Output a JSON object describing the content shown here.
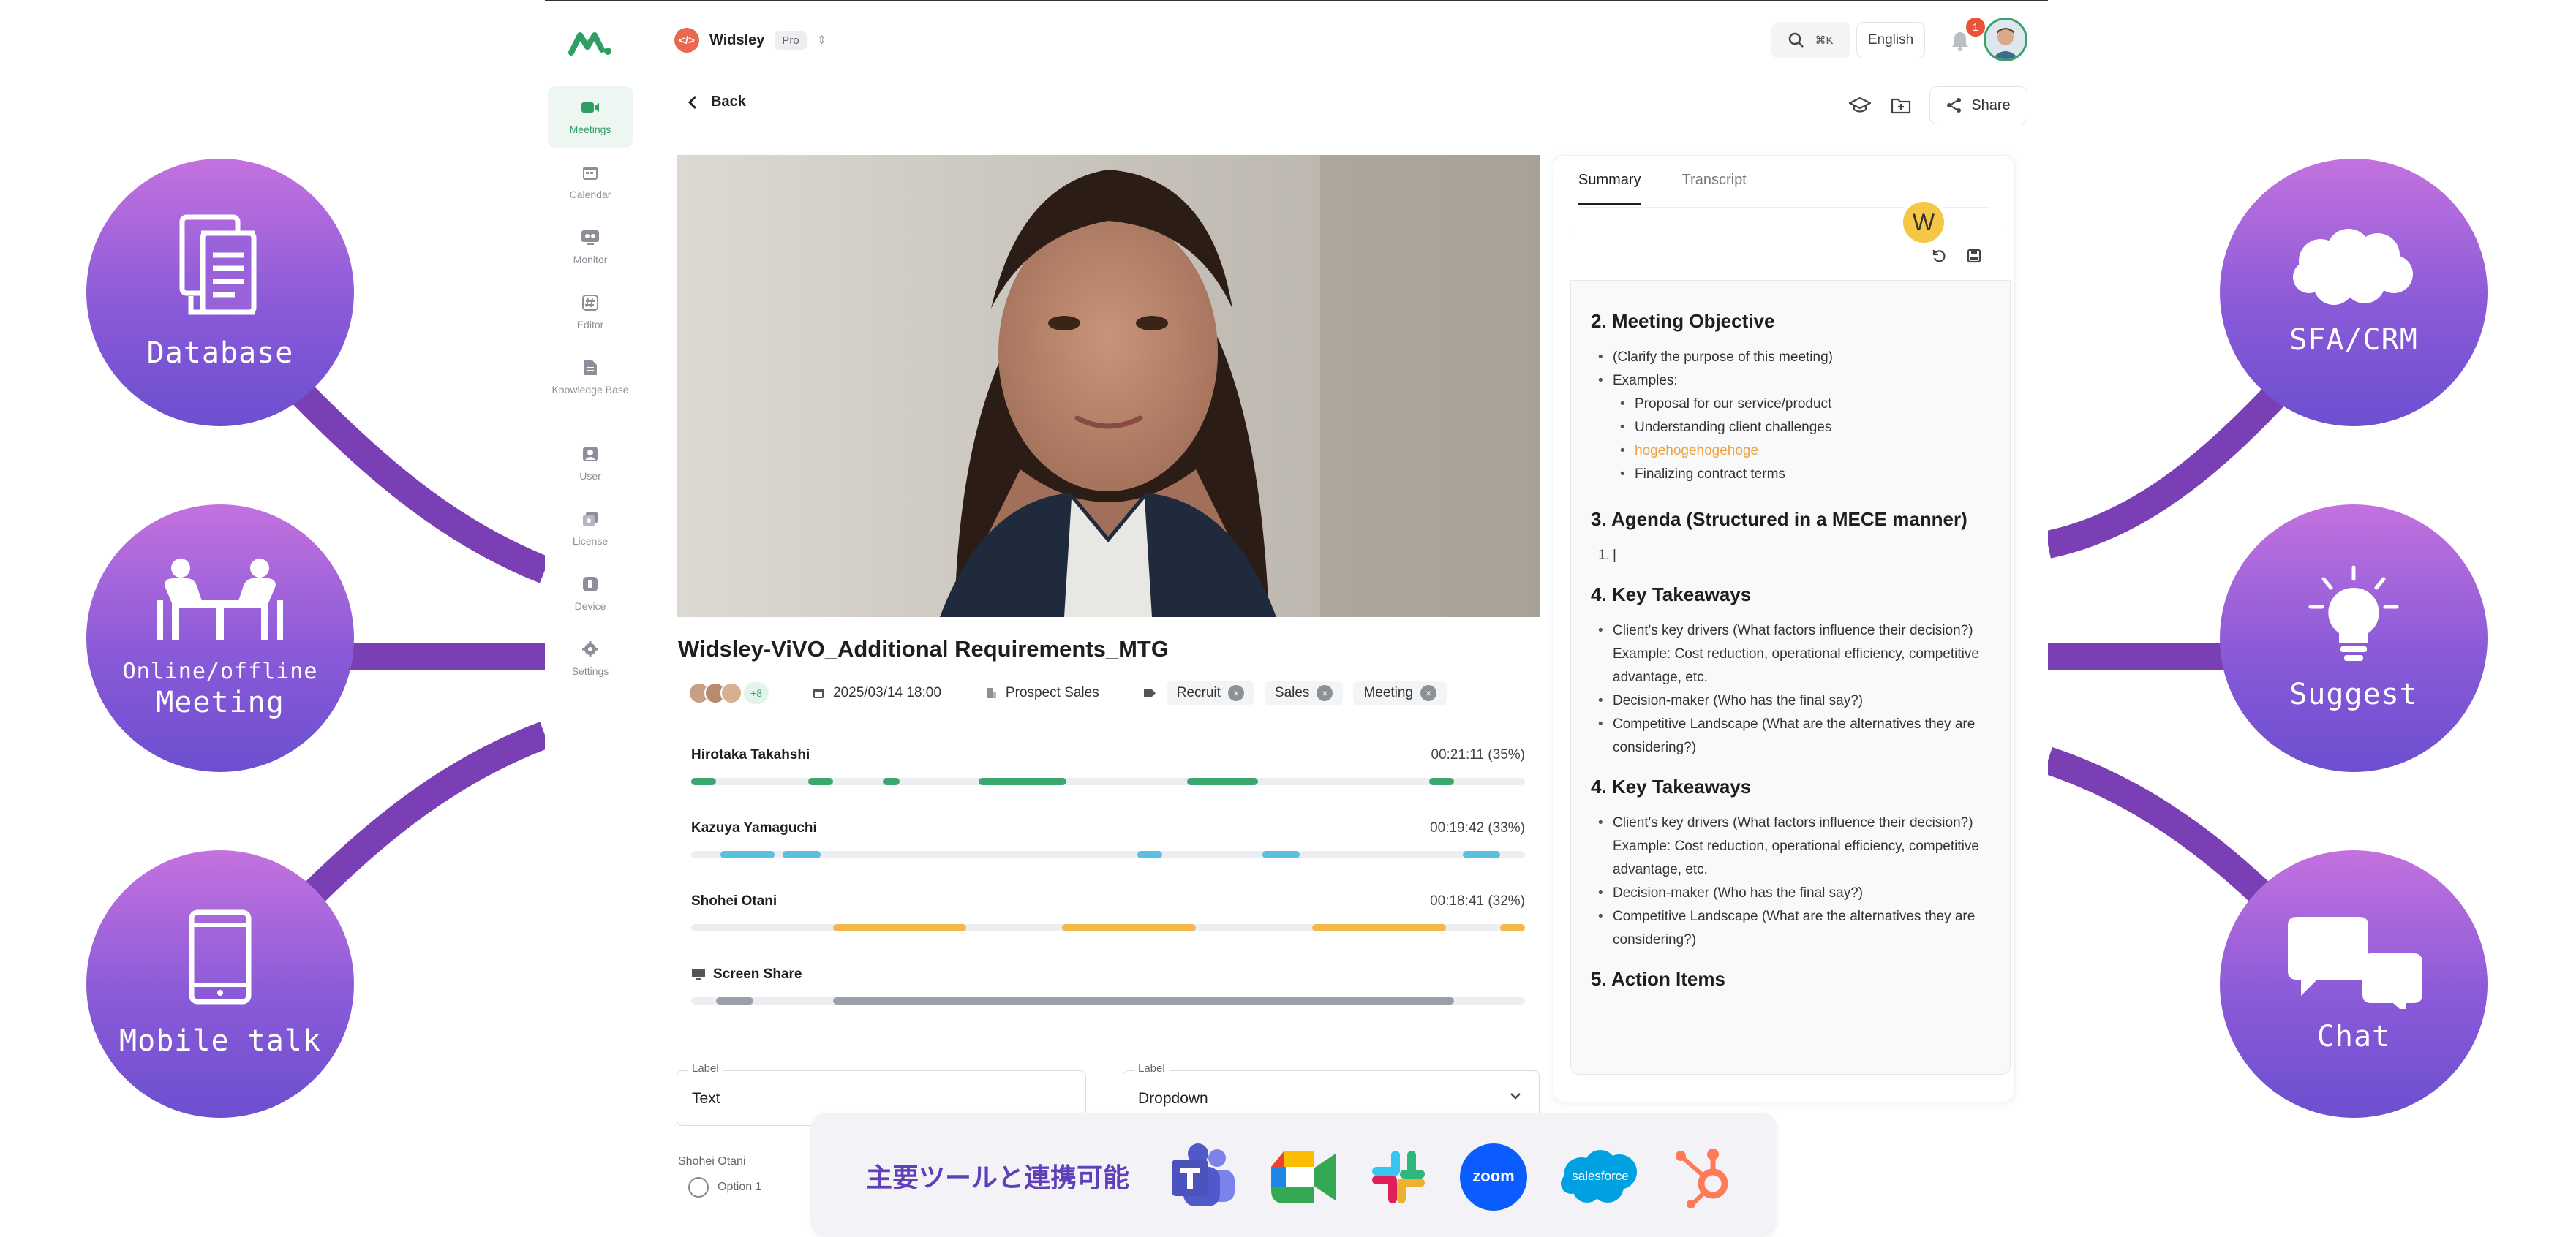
{
  "features_left": [
    {
      "label": "Database",
      "icon": "document-icon"
    },
    {
      "label_small": "Online/offline",
      "label": "Meeting",
      "icon": "meeting-table-icon"
    },
    {
      "label": "Mobile talk",
      "icon": "smartphone-icon"
    }
  ],
  "features_right": [
    {
      "label": "SFA/CRM",
      "icon": "cloud-icon"
    },
    {
      "label": "Suggest",
      "icon": "lightbulb-icon"
    },
    {
      "label": "Chat",
      "icon": "chat-bubbles-icon"
    }
  ],
  "colors": {
    "accent": "#2e9e63",
    "bubble": "#8a5ad8",
    "connector": "#7a3fb4",
    "integration_text": "#6040b8"
  },
  "sidebar": {
    "items": [
      {
        "label": "Meetings",
        "icon": "video-icon",
        "active": true
      },
      {
        "label": "Calendar",
        "icon": "calendar-icon"
      },
      {
        "label": "Monitor",
        "icon": "monitor-icon"
      },
      {
        "label": "Editor",
        "icon": "hash-icon"
      },
      {
        "label": "Knowledge Base",
        "icon": "knowledge-icon"
      },
      {
        "label": "User",
        "icon": "user-icon"
      },
      {
        "label": "License",
        "icon": "license-icon"
      },
      {
        "label": "Device",
        "icon": "device-icon"
      },
      {
        "label": "Settings",
        "icon": "settings-icon"
      }
    ]
  },
  "header": {
    "workspace": "Widsley",
    "plan": "Pro",
    "search_shortcut": "⌘K",
    "language": "English",
    "notifications": "1"
  },
  "toolbar": {
    "back": "Back",
    "share": "Share"
  },
  "meeting": {
    "title": "Widsley-ViVO_Additional Requirements_MTG",
    "participants_more": "+8",
    "datetime": "2025/03/14 18:00",
    "category": "Prospect Sales",
    "tags": [
      "Recruit",
      "Sales",
      "Meeting"
    ]
  },
  "speakers": [
    {
      "name": "Hirotaka Takahshi",
      "time": "00:21:11 (35%)",
      "color": "#3aa76d",
      "segments": [
        [
          0,
          0.03
        ],
        [
          0.14,
          0.17
        ],
        [
          0.23,
          0.25
        ],
        [
          0.345,
          0.45
        ],
        [
          0.595,
          0.68
        ],
        [
          0.885,
          0.915
        ]
      ]
    },
    {
      "name": "Kazuya Yamaguchi",
      "time": "00:19:42 (33%)",
      "color": "#5bbfdf",
      "segments": [
        [
          0.035,
          0.1
        ],
        [
          0.11,
          0.155
        ],
        [
          0.535,
          0.565
        ],
        [
          0.685,
          0.73
        ],
        [
          0.925,
          0.97
        ]
      ]
    },
    {
      "name": "Shohei Otani",
      "time": "00:18:41 (32%)",
      "color": "#f2b84b",
      "segments": [
        [
          0.17,
          0.33
        ],
        [
          0.445,
          0.605
        ],
        [
          0.745,
          0.905
        ],
        [
          0.97,
          1.0
        ]
      ]
    },
    {
      "name": "Screen Share",
      "time": "",
      "color": "#9aa0a8",
      "segments": [
        [
          0.03,
          0.075
        ],
        [
          0.17,
          0.915
        ]
      ]
    }
  ],
  "form": {
    "text_label": "Label",
    "text_value": "Text",
    "dropdown_label": "Label",
    "dropdown_value": "Dropdown",
    "bottom_name": "Shohei Otani",
    "bottom_option": "Option 1"
  },
  "panel": {
    "tabs": [
      "Summary",
      "Transcript"
    ],
    "cursor_badge": "W",
    "sections": [
      {
        "heading": "2. Meeting Objective",
        "items": [
          {
            "text": "(Clarify the purpose of this meeting)",
            "level": 1
          },
          {
            "text": "Examples:",
            "level": 1
          },
          {
            "text": "Proposal for our service/product",
            "level": 2
          },
          {
            "text": "Understanding client challenges",
            "level": 2
          },
          {
            "text": "hogehogehogehoge",
            "level": 2,
            "accent": true
          },
          {
            "text": "Finalizing contract terms",
            "level": 2
          }
        ]
      },
      {
        "heading": "3. Agenda (Structured in a MECE manner)",
        "items": [
          {
            "text": "|",
            "level": 1,
            "numbered": true
          }
        ]
      },
      {
        "heading": "4. Key Takeaways",
        "items": [
          {
            "text": "Client's key drivers (What factors influence their decision?)",
            "level": 1
          },
          {
            "text": "Example: Cost reduction, operational efficiency, competitive advantage, etc.",
            "level": 0
          },
          {
            "text": "Decision-maker (Who has the final say?)",
            "level": 1
          },
          {
            "text": "Competitive Landscape (What are the alternatives they are considering?)",
            "level": 1
          }
        ]
      },
      {
        "heading": "4. Key Takeaways",
        "items": [
          {
            "text": "Client's key drivers (What factors influence their decision?)",
            "level": 1
          },
          {
            "text": "Example: Cost reduction, operational efficiency, competitive advantage, etc.",
            "level": 0
          },
          {
            "text": "Decision-maker (Who has the final say?)",
            "level": 1
          },
          {
            "text": "Competitive Landscape (What are the alternatives they are considering?)",
            "level": 1
          }
        ]
      },
      {
        "heading": "5. Action Items",
        "items": []
      }
    ]
  },
  "integration": {
    "text": "主要ツールと連携可能",
    "logos": [
      "teams-logo",
      "google-meet-logo",
      "slack-logo",
      "zoom-logo",
      "salesforce-logo",
      "hubspot-logo"
    ],
    "zoom_text": "zoom",
    "salesforce_text": "salesforce"
  }
}
